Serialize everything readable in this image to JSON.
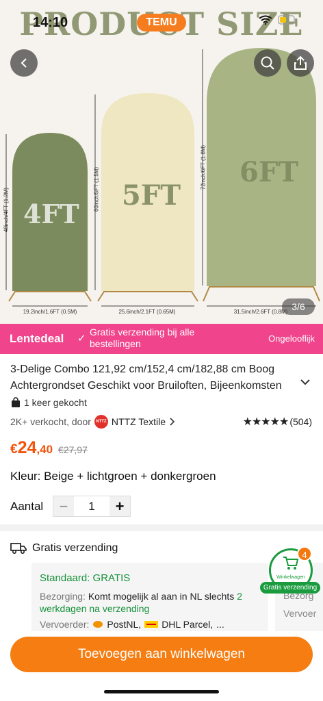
{
  "status": {
    "time": "14:10",
    "app_badge": "TEMU"
  },
  "hero": {
    "banner_text": "PRODUCT SIZE",
    "arches": [
      {
        "label": "4FT",
        "height_label": "48inch/4FT (1.2M)",
        "width_label": "19.2inch/1.6FT (0.5M)"
      },
      {
        "label": "5FT",
        "height_label": "60inch/5FT (1.5M)",
        "width_label": "25.6inch/2.1FT (0.65M)"
      },
      {
        "label": "6FT",
        "height_label": "72inch/6FT (1.8M)",
        "width_label": "31.5inch/2.6FT (0.8M)"
      }
    ],
    "page_indicator": "3/6",
    "icons": {
      "back": "chevron-left-icon",
      "search": "search-icon",
      "share": "share-icon"
    }
  },
  "deal": {
    "name": "Lentedeal",
    "check": "✓",
    "text": "Gratis verzending bij alle bestellingen",
    "right": "Ongelooflijk"
  },
  "product": {
    "title": "3-Delige Combo 121,92 cm/152,4 cm/182,88 cm Boog Achtergrondset Geschikt voor Bruiloften, Bijeenkomsten",
    "bought": "1 keer gekocht",
    "sold_prefix": "2K+ verkocht, door",
    "seller_logo": "NTTZ",
    "seller": "NTTZ Textile",
    "rating_stars": 5,
    "reviews": "(504)",
    "price_currency": "€",
    "price_int": "24",
    "price_dec": ",40",
    "price_old": "€27,97",
    "color_label": "Kleur: Beige + lichtgroen + donkergroen",
    "qty_label": "Aantal",
    "qty_minus": "−",
    "qty_value": "1",
    "qty_plus": "+"
  },
  "shipping": {
    "heading": "Gratis verzending",
    "standard": "Standaard: GRATIS",
    "delivery_label": "Bezorging:",
    "delivery_text": "Komt mogelijk al aan in NL slechts",
    "delivery_highlight": "2 werkdagen na verzending",
    "carrier_label": "Vervoerder:",
    "carrier_1": "PostNL,",
    "carrier_2": "DHL Parcel,",
    "carrier_more": "...",
    "card2_line1": "Bezorg",
    "card2_line2": "Vervoer"
  },
  "cart": {
    "label": "Winkelwagen",
    "count": "4",
    "free": "Gratis verzending"
  },
  "cta": {
    "add_to_cart": "Toevoegen aan winkelwagen"
  },
  "colors": {
    "accent": "#f57d11",
    "deal": "#f0448c",
    "price": "#f5530c",
    "green": "#17913b",
    "arch_4ft": "#7c8b5d",
    "arch_5ft": "#efe6c2",
    "arch_6ft": "#a9b485"
  }
}
